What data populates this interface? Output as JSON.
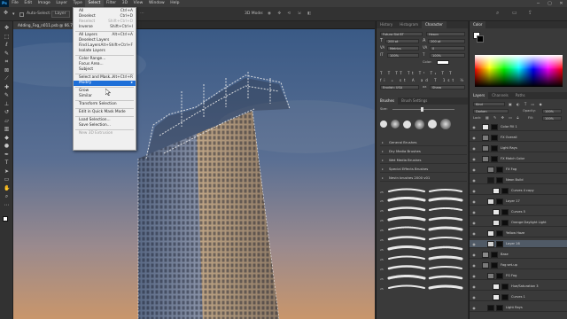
{
  "menubar": {
    "logo": "Ps",
    "items": [
      "File",
      "Edit",
      "Image",
      "Layer",
      "Type",
      "Select",
      "Filter",
      "3D",
      "View",
      "Window",
      "Help"
    ],
    "active": "Select",
    "window_controls": [
      "─",
      "▢",
      "✕"
    ]
  },
  "options": {
    "auto_select": "Auto-Select:",
    "layer_label": "Layer",
    "mode_3d": "3D Mode:"
  },
  "document": {
    "tab_title": "Adding_Fog_n011.psb @ 66.7% (Layer 12, RGB/8) *"
  },
  "select_menu": {
    "items": [
      {
        "label": "All",
        "shortcut": "Ctrl+A",
        "disabled": false
      },
      {
        "label": "Deselect",
        "shortcut": "Ctrl+D",
        "disabled": false
      },
      {
        "label": "Reselect",
        "shortcut": "Shift+Ctrl+D",
        "disabled": true
      },
      {
        "label": "Inverse",
        "shortcut": "Shift+Ctrl+I",
        "disabled": false
      },
      {
        "sep": true
      },
      {
        "label": "All Layers",
        "shortcut": "Alt+Ctrl+A",
        "disabled": false
      },
      {
        "label": "Deselect Layers",
        "shortcut": "",
        "disabled": false
      },
      {
        "label": "Find Layers",
        "shortcut": "Alt+Shift+Ctrl+F",
        "disabled": false
      },
      {
        "label": "Isolate Layers",
        "shortcut": "",
        "disabled": false
      },
      {
        "sep": true
      },
      {
        "label": "Color Range...",
        "shortcut": "",
        "disabled": false
      },
      {
        "label": "Focus Area...",
        "shortcut": "",
        "disabled": false
      },
      {
        "label": "Subject",
        "shortcut": "",
        "disabled": false
      },
      {
        "sep": true
      },
      {
        "label": "Select and Mask...",
        "shortcut": "Alt+Ctrl+R",
        "disabled": false
      },
      {
        "label": "Modify",
        "shortcut": "▸",
        "disabled": false,
        "highlight": true
      },
      {
        "sep": true
      },
      {
        "label": "Grow",
        "shortcut": "",
        "disabled": false
      },
      {
        "label": "Similar",
        "shortcut": "",
        "disabled": false
      },
      {
        "sep": true
      },
      {
        "label": "Transform Selection",
        "shortcut": "",
        "disabled": false
      },
      {
        "sep": true
      },
      {
        "label": "Edit in Quick Mask Mode",
        "shortcut": "",
        "disabled": false
      },
      {
        "sep": true
      },
      {
        "label": "Load Selection...",
        "shortcut": "",
        "disabled": false
      },
      {
        "label": "Save Selection...",
        "shortcut": "",
        "disabled": false
      },
      {
        "sep": true
      },
      {
        "label": "New 3D Extrusion",
        "shortcut": "",
        "disabled": true
      }
    ]
  },
  "character_panel": {
    "tabs": [
      "History",
      "Histogram",
      "Character"
    ],
    "active": "Character",
    "font": "Futura Std BT",
    "style": "Heavy",
    "size": "200 pt",
    "leading": "200 pt",
    "tracking": "0",
    "kerning": "Metrics",
    "scale_v": "100%",
    "scale_h": "100%",
    "color_label": "Color:",
    "language": "English: USA",
    "aa": "Sharp"
  },
  "brushes_panel": {
    "tabs": [
      "Brushes",
      "Brush Settings"
    ],
    "active": "Brushes",
    "size": "Size:",
    "folders": [
      "General Brushes",
      "Dry Media Brushes",
      "Wet Media Brushes",
      "Special Effects Brushes",
      "Nevin brushes 2000 v01"
    ]
  },
  "color_panel": {
    "tabs": [
      "Color"
    ],
    "active": "Color"
  },
  "layers_panel": {
    "tabs": [
      "Layers",
      "Channels",
      "Paths"
    ],
    "active": "Layers",
    "kind": "Kind",
    "blend": "Darken",
    "opacity_label": "Opacity:",
    "opacity": "100%",
    "lock_label": "Lock:",
    "fill_label": "Fill:",
    "fill": "100%",
    "layers": [
      {
        "name": "Color Fill 1",
        "indent": 0,
        "thumb": "#e8e8e8",
        "sel": false
      },
      {
        "name": "FX Overall",
        "indent": 0,
        "thumb": "#7a7a7a",
        "sel": false
      },
      {
        "name": "Light Rays",
        "indent": 0,
        "thumb": "#7a7a7a",
        "sel": false
      },
      {
        "name": "FX Match Color",
        "indent": 0,
        "thumb": "#7a7a7a",
        "sel": false
      },
      {
        "name": "FX Fog",
        "indent": 1,
        "thumb": "#7a7a7a",
        "sel": false
      },
      {
        "name": "Neon Build",
        "indent": 1,
        "thumb": "#1a1a1a",
        "sel": false
      },
      {
        "name": "Curves 4 copy",
        "indent": 2,
        "thumb": "#eaeaea",
        "sel": false
      },
      {
        "name": "Layer 17",
        "indent": 1,
        "thumb": "#d8d8d8",
        "sel": false
      },
      {
        "name": "Curves 5",
        "indent": 2,
        "thumb": "#eaeaea",
        "sel": false
      },
      {
        "name": "Orange Daylight Light",
        "indent": 2,
        "thumb": "#e0e0e0",
        "sel": false
      },
      {
        "name": "Yellow Haze",
        "indent": 1,
        "thumb": "#dedede",
        "sel": false
      },
      {
        "name": "Layer 16",
        "indent": 1,
        "thumb": "#cfcfcf",
        "sel": true
      },
      {
        "name": "Base",
        "indent": 0,
        "thumb": "#8c8c8c",
        "sel": false
      },
      {
        "name": "Fog set-up",
        "indent": 0,
        "thumb": "#7a7a7a",
        "sel": false
      },
      {
        "name": "FG Fog",
        "indent": 1,
        "thumb": "#7a7a7a",
        "sel": false
      },
      {
        "name": "Hue/Saturation 3",
        "indent": 2,
        "thumb": "#eaeaea",
        "sel": false
      },
      {
        "name": "Curves 1",
        "indent": 2,
        "thumb": "#eaeaea",
        "sel": false
      },
      {
        "name": "Light Rays",
        "indent": 1,
        "thumb": "#111111",
        "sel": false
      }
    ]
  },
  "colors": {
    "accent": "#1e6fd8",
    "sky_top": "#3a5a86",
    "sky_bottom": "#c9966b"
  }
}
